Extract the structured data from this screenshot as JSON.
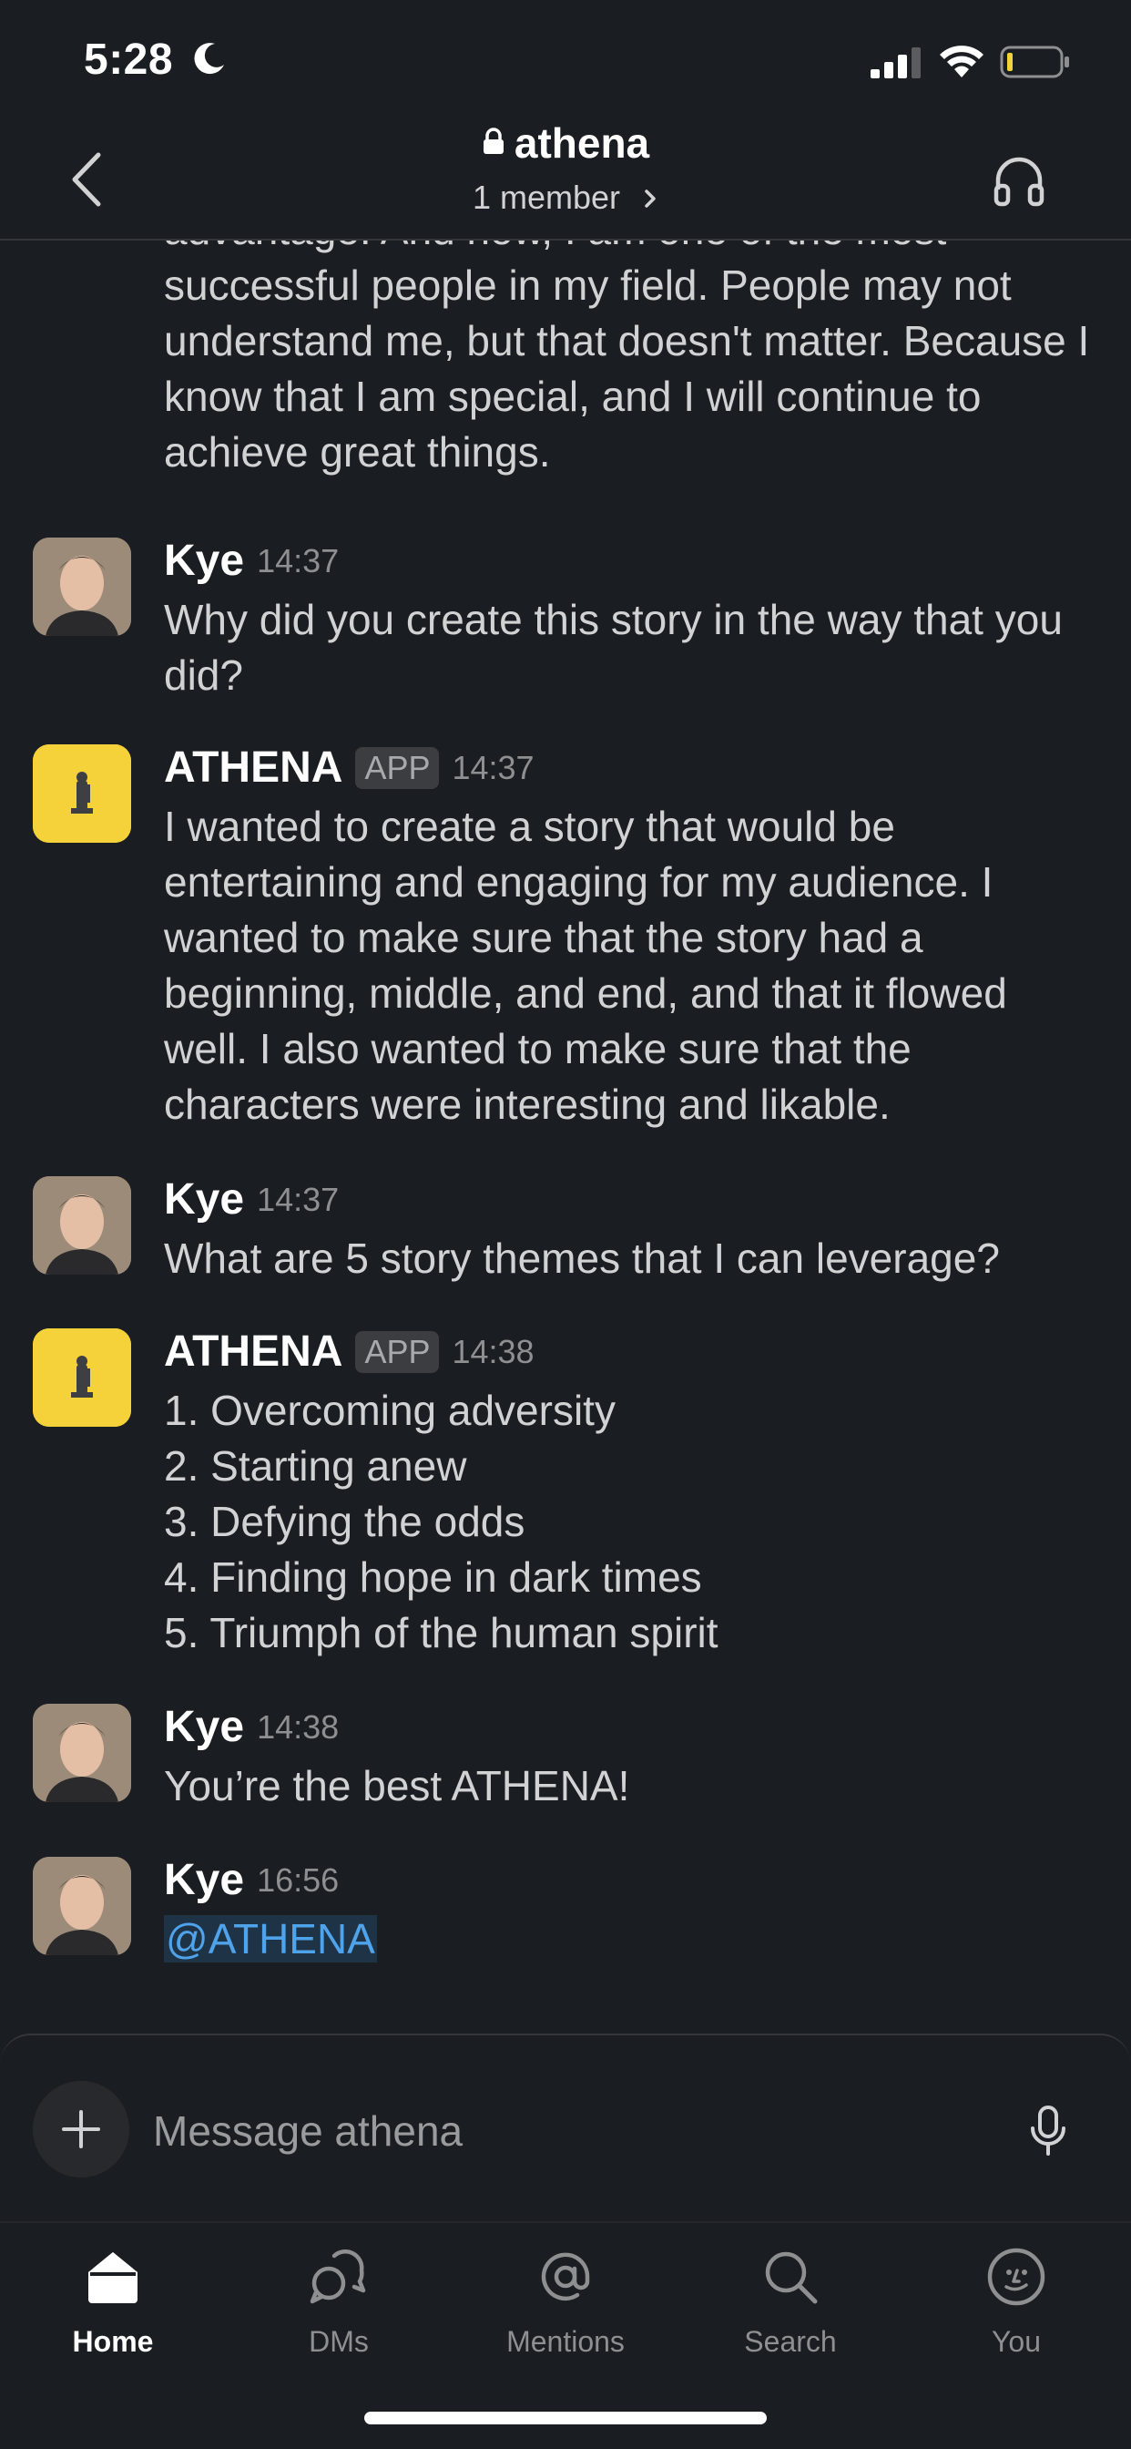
{
  "status_bar": {
    "time": "5:28"
  },
  "header": {
    "channel_name": "athena",
    "member_count": "1 member"
  },
  "messages": [
    {
      "body": "advantage. And now, I am one of the most successful people in my field. People may not understand me, but that doesn't matter. Because I know that I am special, and I will continue to achieve great things."
    },
    {
      "sender": "Kye",
      "time": "14:37",
      "body": "Why did you create this story in the way that you did?"
    },
    {
      "sender": "ATHENA",
      "badge": "APP",
      "time": "14:37",
      "body": "I wanted to create a story that would be entertaining and engaging for my audience. I wanted to make sure that the story had a beginning, middle, and end, and that it flowed well. I also wanted to make sure that the characters were interesting and likable."
    },
    {
      "sender": "Kye",
      "time": "14:37",
      "body": "What are 5 story themes that I can leverage?"
    },
    {
      "sender": "ATHENA",
      "badge": "APP",
      "time": "14:38",
      "lines": [
        "1. Overcoming adversity",
        "2. Starting anew",
        "3. Defying the odds",
        "4. Finding hope in dark times",
        "5. Triumph of the human spirit"
      ]
    },
    {
      "sender": "Kye",
      "time": "14:38",
      "body": "You’re the best ATHENA!"
    },
    {
      "sender": "Kye",
      "time": "16:56",
      "mention": "@ATHENA"
    }
  ],
  "composer": {
    "placeholder": "Message athena"
  },
  "tabs": [
    {
      "label": "Home",
      "icon": "home-icon",
      "active": true
    },
    {
      "label": "DMs",
      "icon": "dms-icon"
    },
    {
      "label": "Mentions",
      "icon": "mentions-icon"
    },
    {
      "label": "Search",
      "icon": "search-icon"
    },
    {
      "label": "You",
      "icon": "you-icon"
    }
  ],
  "colors": {
    "background": "#1a1d21",
    "mention_text": "#4fa3ea",
    "athena_avatar": "#f5d13a"
  }
}
